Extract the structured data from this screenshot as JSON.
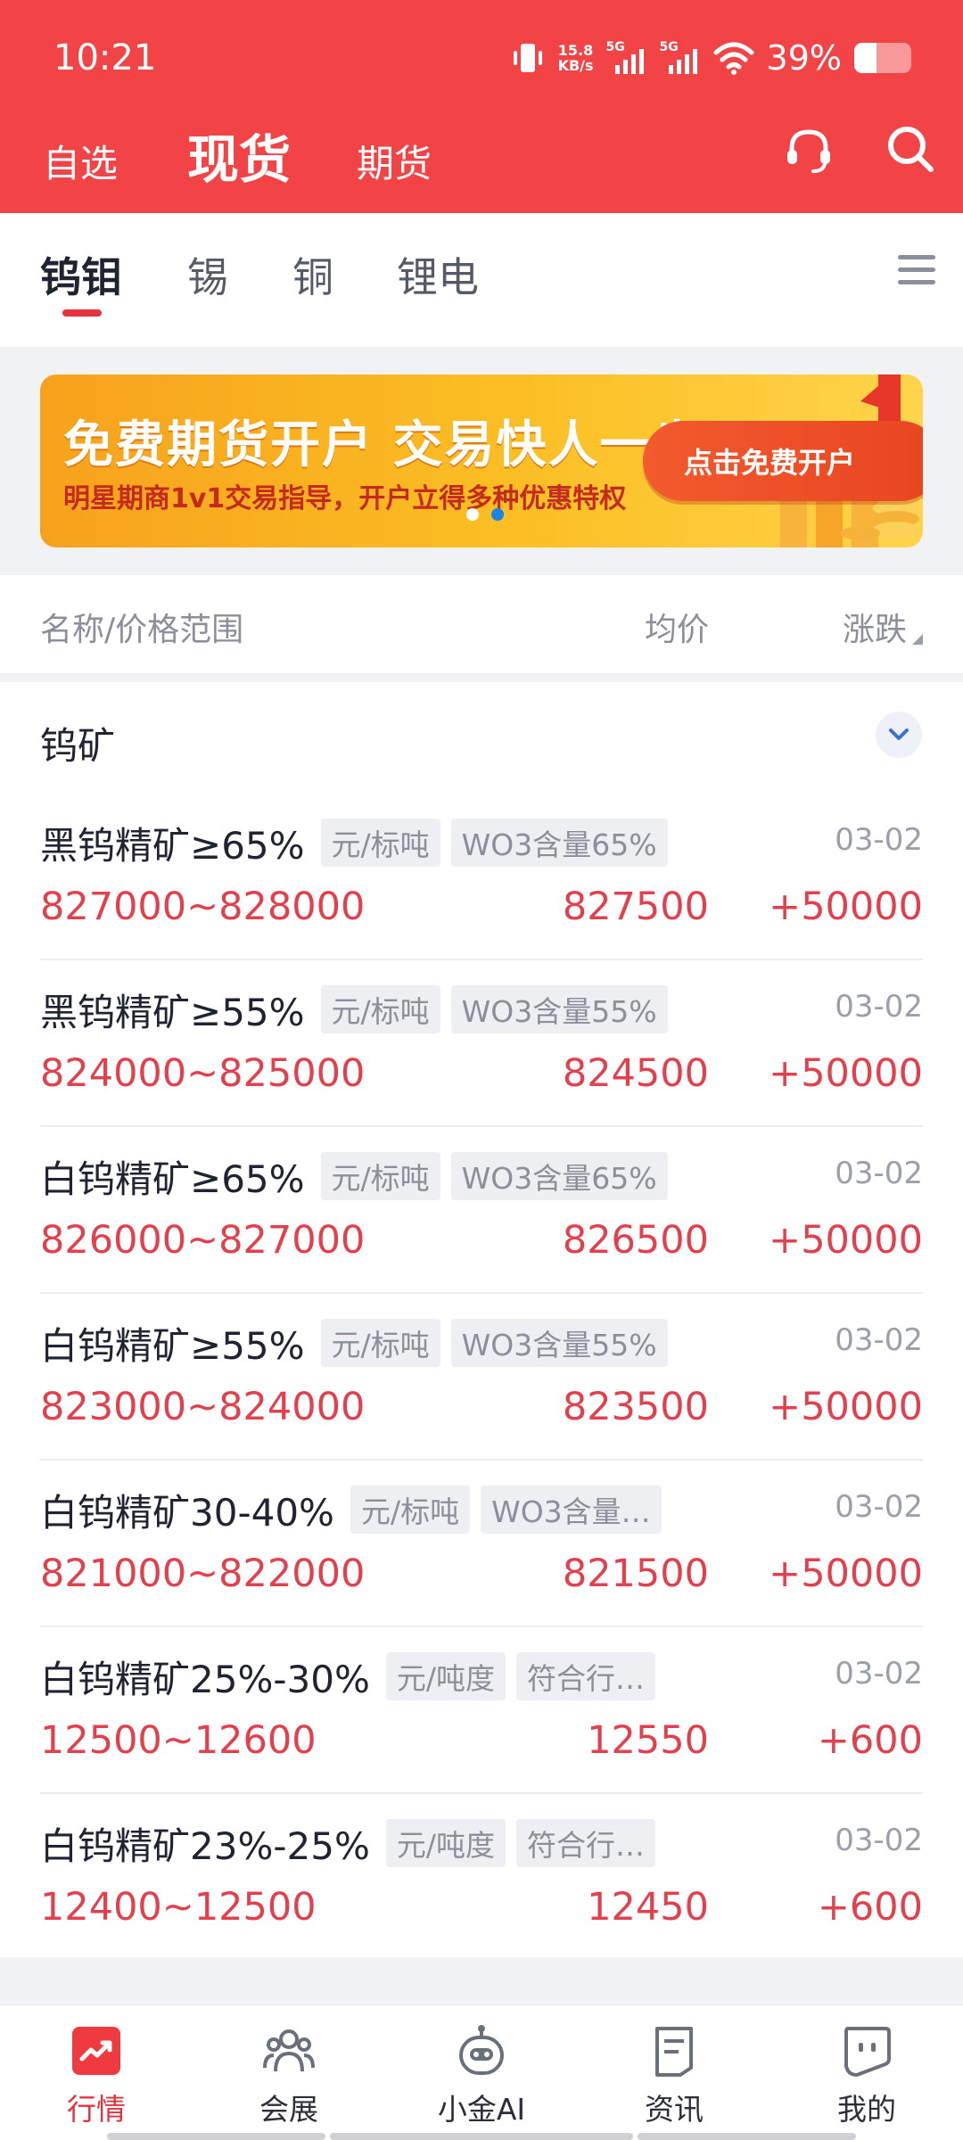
{
  "status_bar": {
    "time": "10:21",
    "net_speed_value": "15.8",
    "net_speed_unit": "KB/s",
    "sim1_label": "5G",
    "sim2_label": "5G",
    "battery_percent": "39%",
    "battery_level": 0.39
  },
  "header": {
    "tabs": [
      "自选",
      "现货",
      "期货"
    ],
    "active_tab": "现货",
    "bg_color": "#f24446"
  },
  "category_tabs": {
    "items": [
      "钨钼",
      "锡",
      "铜",
      "锂电"
    ],
    "active": "钨钼"
  },
  "banner": {
    "title": "免费期货开户  交易快人一步",
    "subtitle": "明星期商1v1交易指导，开户立得多种优惠特权",
    "cta": "点击免费开户",
    "slide_count": 2,
    "active_slide": 2
  },
  "columns": {
    "name": "名称/价格范围",
    "avg": "均价",
    "change": "涨跌"
  },
  "group": {
    "title": "钨矿",
    "rows": [
      {
        "name": "黑钨精矿≥65%",
        "unit": "元/标吨",
        "spec": "WO3含量65%",
        "date": "03-02",
        "range": "827000~828000",
        "avg": "827500",
        "change": "+50000"
      },
      {
        "name": "黑钨精矿≥55%",
        "unit": "元/标吨",
        "spec": "WO3含量55%",
        "date": "03-02",
        "range": "824000~825000",
        "avg": "824500",
        "change": "+50000"
      },
      {
        "name": "白钨精矿≥65%",
        "unit": "元/标吨",
        "spec": "WO3含量65%",
        "date": "03-02",
        "range": "826000~827000",
        "avg": "826500",
        "change": "+50000"
      },
      {
        "name": "白钨精矿≥55%",
        "unit": "元/标吨",
        "spec": "WO3含量55%",
        "date": "03-02",
        "range": "823000~824000",
        "avg": "823500",
        "change": "+50000"
      },
      {
        "name": "白钨精矿30-40%",
        "unit": "元/标吨",
        "spec": "WO3含量…",
        "date": "03-02",
        "range": "821000~822000",
        "avg": "821500",
        "change": "+50000"
      },
      {
        "name": "白钨精矿25%-30%",
        "unit": "元/吨度",
        "spec": "符合行…",
        "date": "03-02",
        "range": "12500~12600",
        "avg": "12550",
        "change": "+600"
      },
      {
        "name": "白钨精矿23%-25%",
        "unit": "元/吨度",
        "spec": "符合行…",
        "date": "03-02",
        "range": "12400~12500",
        "avg": "12450",
        "change": "+600"
      }
    ]
  },
  "bottom_nav": {
    "items": [
      {
        "label": "行情",
        "icon": "chart-icon"
      },
      {
        "label": "会展",
        "icon": "people-icon"
      },
      {
        "label": "小金AI",
        "icon": "robot-icon"
      },
      {
        "label": "资讯",
        "icon": "document-icon"
      },
      {
        "label": "我的",
        "icon": "profile-icon"
      }
    ],
    "active": "行情"
  },
  "colors": {
    "up_red": "#e2404d",
    "accent_red": "#e6323e",
    "link_blue": "#3b6fd8"
  }
}
